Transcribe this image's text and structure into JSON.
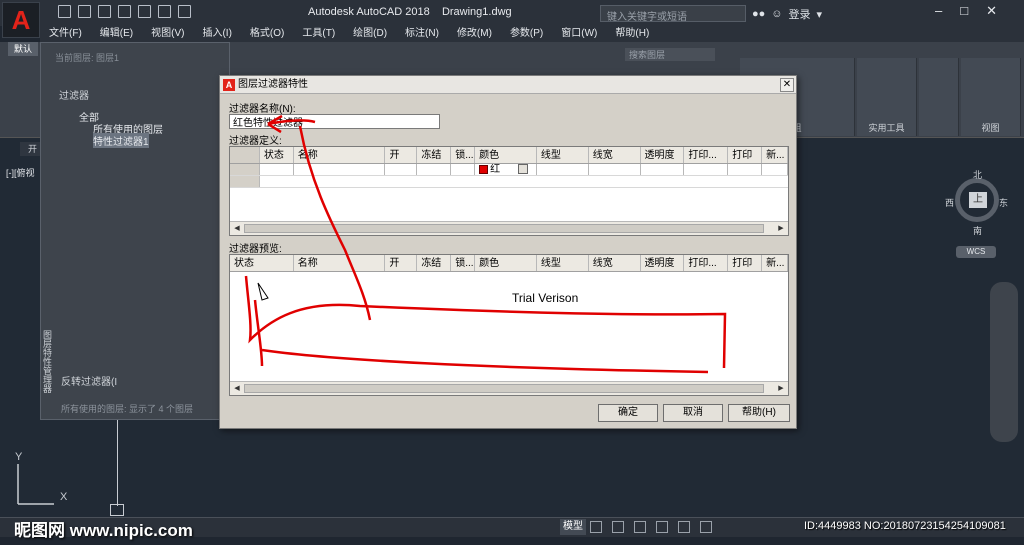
{
  "app": {
    "title": "Autodesk AutoCAD 2018",
    "document": "Drawing1.dwg",
    "search_placeholder": "键入关键字或短语",
    "login_label": "登录"
  },
  "menu": [
    "文件(F)",
    "编辑(E)",
    "视图(V)",
    "插入(I)",
    "格式(O)",
    "工具(T)",
    "绘图(D)",
    "标注(N)",
    "修改(M)",
    "参数(P)",
    "窗口(W)",
    "帮助(H)"
  ],
  "ribbon": {
    "tab_default": "默认",
    "panels": [
      "组",
      "实用工具",
      "视图"
    ]
  },
  "viewport": {
    "doc_tab": "开",
    "view_label": "[-][俯视"
  },
  "layer_manager": {
    "current_layer": "当前图层: 图层1",
    "filters_label": "过滤器",
    "tree_all": "全部",
    "tree_used": "所有使用的图层",
    "tree_props": "特性过滤器1",
    "invert_label": "反转过滤器(I",
    "status_text": "所有使用的图层: 显示了 4 个图层",
    "vertical_label": "图层特性管理器",
    "search_layers": "搜索图层"
  },
  "compass": {
    "north": "北",
    "south": "南",
    "east": "东",
    "west": "西",
    "top": "上",
    "wcs": "WCS"
  },
  "dialog": {
    "title": "图层过滤器特性",
    "name_label": "过滤器名称(N):",
    "name_value": "红色特性过滤器",
    "definition_label": "过滤器定义:",
    "preview_label": "过滤器预览:",
    "columns": [
      "状态",
      "名称",
      "开",
      "冻结",
      "锁...",
      "颜色",
      "线型",
      "线宽",
      "透明度",
      "打印...",
      "打印",
      "新..."
    ],
    "definition_color_value": "红",
    "trial_text": "Trial Verison",
    "buttons": {
      "ok": "确定",
      "cancel": "取消",
      "help": "帮助(H)"
    },
    "swatch_color": "#e00000"
  },
  "statusbar": {
    "model": "模型"
  },
  "watermark": {
    "site": "昵图网 www.nipic.com",
    "id": "ID:4449983 NO:20180723154254109081"
  },
  "colors": {
    "app_background": "#1f2630",
    "dialog_background": "#d4d0c8",
    "annotation_red": "#e00000",
    "autocad_red": "#e2231a"
  }
}
